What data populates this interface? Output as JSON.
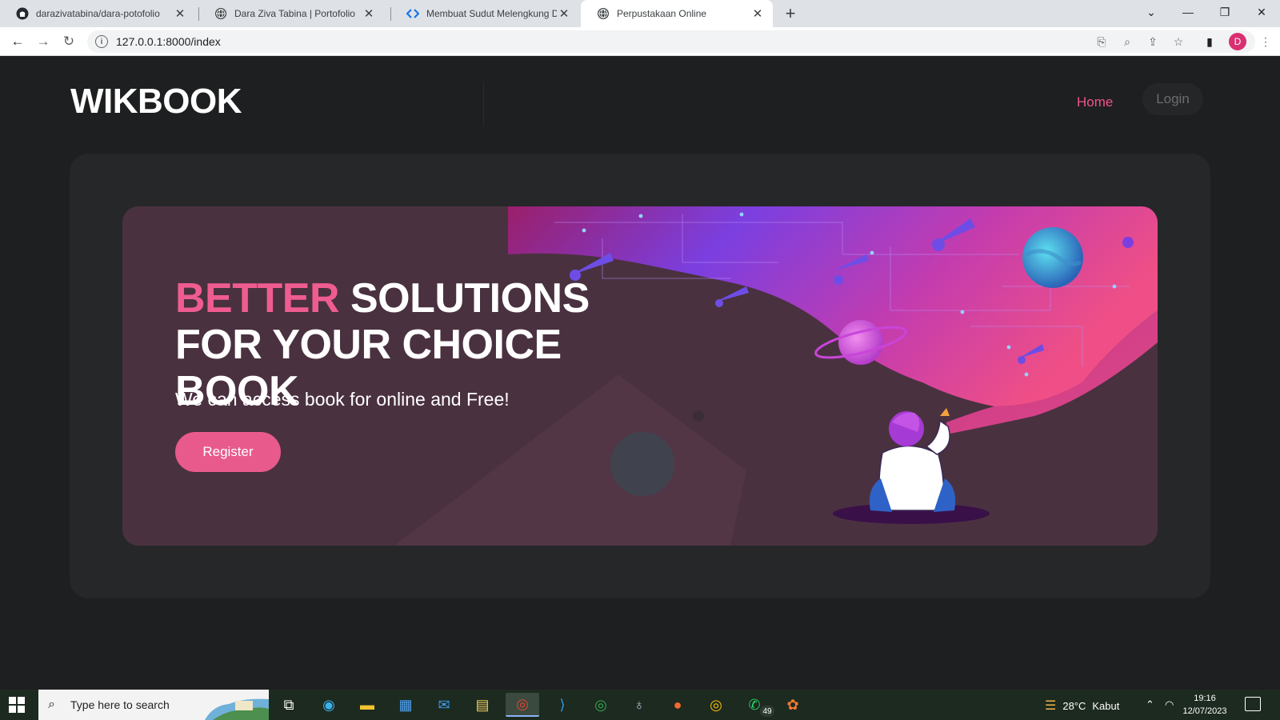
{
  "browser": {
    "tabs": [
      {
        "title": "darazivatabina/dara-potofolio",
        "icon": "github-icon"
      },
      {
        "title": "Dara Ziva Tabina | Portofolio",
        "icon": "globe-icon"
      },
      {
        "title": "Membuat Sudut Melengkung De",
        "icon": "code-icon"
      },
      {
        "title": "Perpustakaan Online",
        "icon": "globe-icon",
        "active": true
      }
    ],
    "new_tab": "+",
    "url": "127.0.0.1:8000/index",
    "profile_initial": "D"
  },
  "site": {
    "brand": "WIKBOOK",
    "nav": {
      "home": "Home",
      "login": "Login"
    },
    "hero": {
      "headline_accent": "BETTER",
      "headline_rest": " SOLUTIONS FOR YOUR CHOICE BOOK",
      "subtext": "We can access book for online and Free!",
      "cta": "Register"
    },
    "colors": {
      "accent": "#ef5c8f",
      "background": "#1e1f20",
      "card": "#262729"
    }
  },
  "taskbar": {
    "search_placeholder": "Type here to search",
    "whatsapp_badge": "49",
    "weather": {
      "temp": "28°C",
      "condition": "Kabut"
    },
    "clock": {
      "time": "19:16",
      "date": "12/07/2023"
    }
  }
}
